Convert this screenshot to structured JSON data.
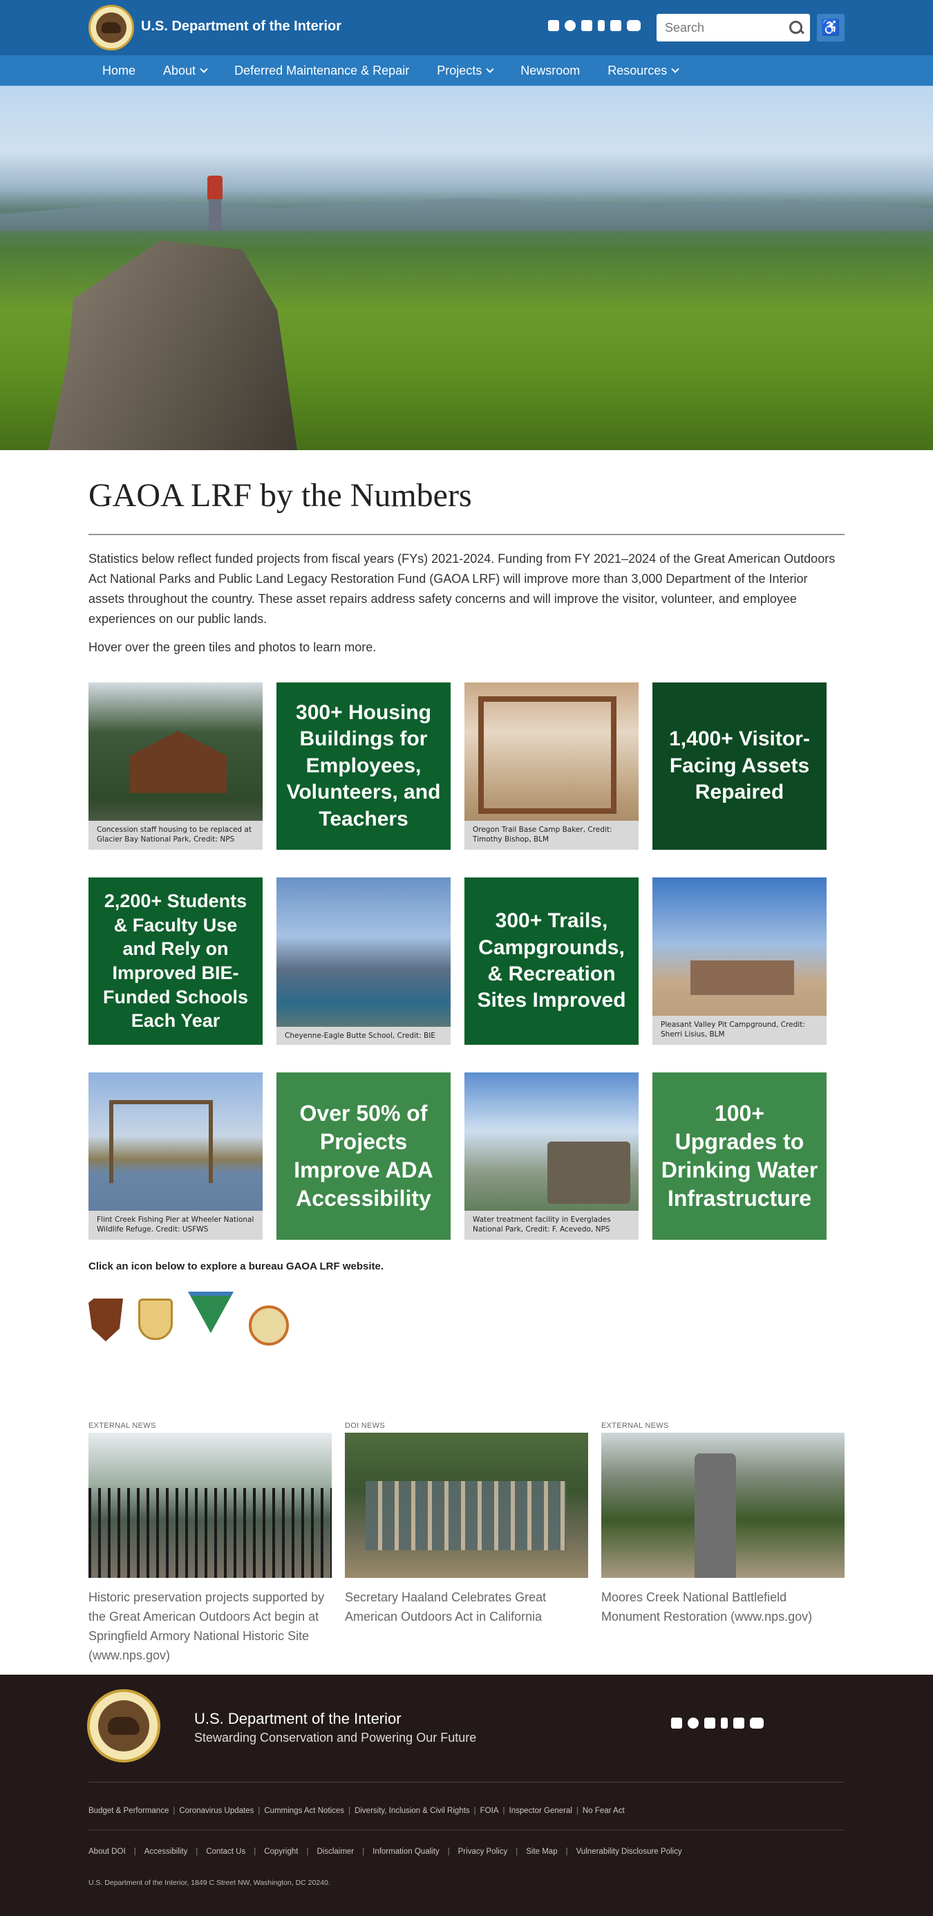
{
  "header": {
    "site_title": "U.S. Department of the Interior",
    "social_icons": [
      "instagram-icon",
      "facebook-icon",
      "twitter-icon",
      "tumblr-icon",
      "flickr-icon",
      "youtube-icon"
    ],
    "search_placeholder": "Search",
    "accessibility_glyph": "♿"
  },
  "nav": {
    "items": [
      {
        "label": "Home",
        "dropdown": false
      },
      {
        "label": "About",
        "dropdown": true
      },
      {
        "label": "Deferred Maintenance & Repair",
        "dropdown": false
      },
      {
        "label": "Projects",
        "dropdown": true
      },
      {
        "label": "Newsroom",
        "dropdown": false
      },
      {
        "label": "Resources",
        "dropdown": true
      }
    ]
  },
  "main": {
    "title": "GAOA LRF by the Numbers",
    "intro": "Statistics below reflect funded projects from fiscal years (FYs) 2021-2024. Funding from FY 2021–2024 of the Great American Outdoors Act National Parks and Public Land Legacy Restoration Fund (GAOA LRF) will improve more than 3,000 Department of the Interior assets throughout the country.  These asset repairs address safety concerns and will improve the visitor, volunteer, and employee experiences on our public lands.",
    "hover_note": "Hover over the green tiles and photos to learn more.",
    "tiles": [
      {
        "kind": "photo",
        "caption": "Concession staff housing to be replaced at Glacier Bay National Park, Credit: NPS"
      },
      {
        "kind": "stat",
        "text": "300+ Housing Buildings for Employees, Volunteers, and Teachers"
      },
      {
        "kind": "photo",
        "caption": "Oregon Trail Base Camp Baker, Credit: Timothy Bishop, BLM"
      },
      {
        "kind": "stat",
        "text": "1,400+ Visitor-Facing Assets Repaired"
      },
      {
        "kind": "stat",
        "text": "2,200+ Students & Faculty Use and Rely on Improved BIE-Funded Schools Each Year"
      },
      {
        "kind": "photo",
        "caption": "Cheyenne-Eagle Butte School, Credit: BIE"
      },
      {
        "kind": "stat",
        "text": "300+ Trails, Campgrounds, & Recreation Sites Improved"
      },
      {
        "kind": "photo",
        "caption": "Pleasant Valley Pit Campground, Credit: Sherri Lisius, BLM"
      },
      {
        "kind": "photo",
        "caption": "Flint Creek Fishing Pier at Wheeler National Wildlife Refuge. Credit: USFWS"
      },
      {
        "kind": "stat",
        "text": "Over 50% of Projects Improve ADA Accessibility"
      },
      {
        "kind": "photo",
        "caption": "Water treatment facility in Everglades National Park, Credit: F. Acevedo, NPS"
      },
      {
        "kind": "stat",
        "text": "100+ Upgrades to Drinking Water Infrastructure"
      }
    ],
    "bureau_note": "Click an icon below to explore a bureau GAOA LRF website.",
    "bureau_icons": [
      "nps-arrowhead-icon",
      "fws-shield-icon",
      "blm-logo-icon",
      "bie-seal-icon"
    ]
  },
  "news": [
    {
      "kicker": "EXTERNAL NEWS",
      "text": "Historic preservation projects supported by the Great American Outdoors Act begin at Springfield Armory National Historic Site (www.nps.gov)"
    },
    {
      "kicker": "DOI NEWS",
      "text": "Secretary Haaland Celebrates Great American Outdoors Act in California"
    },
    {
      "kicker": "EXTERNAL NEWS",
      "text": "Moores Creek National Battlefield Monument Restoration (www.nps.gov)"
    }
  ],
  "footer": {
    "title": "U.S. Department of the Interior",
    "tagline": "Stewarding Conservation and Powering Our Future",
    "links_row1": [
      "Budget & Performance",
      "Coronavirus Updates",
      "Cummings Act Notices",
      "Diversity, Inclusion & Civil Rights",
      "FOIA",
      "Inspector General",
      "No Fear Act"
    ],
    "links_row2": [
      "About DOI",
      "Accessibility",
      "Contact Us",
      "Copyright",
      "Disclaimer",
      "Information Quality",
      "Privacy Policy",
      "Site Map",
      "Vulnerability Disclosure Policy"
    ],
    "address": "U.S. Department of the Interior, 1849 C Street NW, Washington, DC 20240."
  },
  "colors": {
    "header": "#1c63a3",
    "nav": "#2a7bbf",
    "footer": "#221918",
    "stat_dark": "#0d4a23",
    "stat_light": "#3e8a4b"
  }
}
